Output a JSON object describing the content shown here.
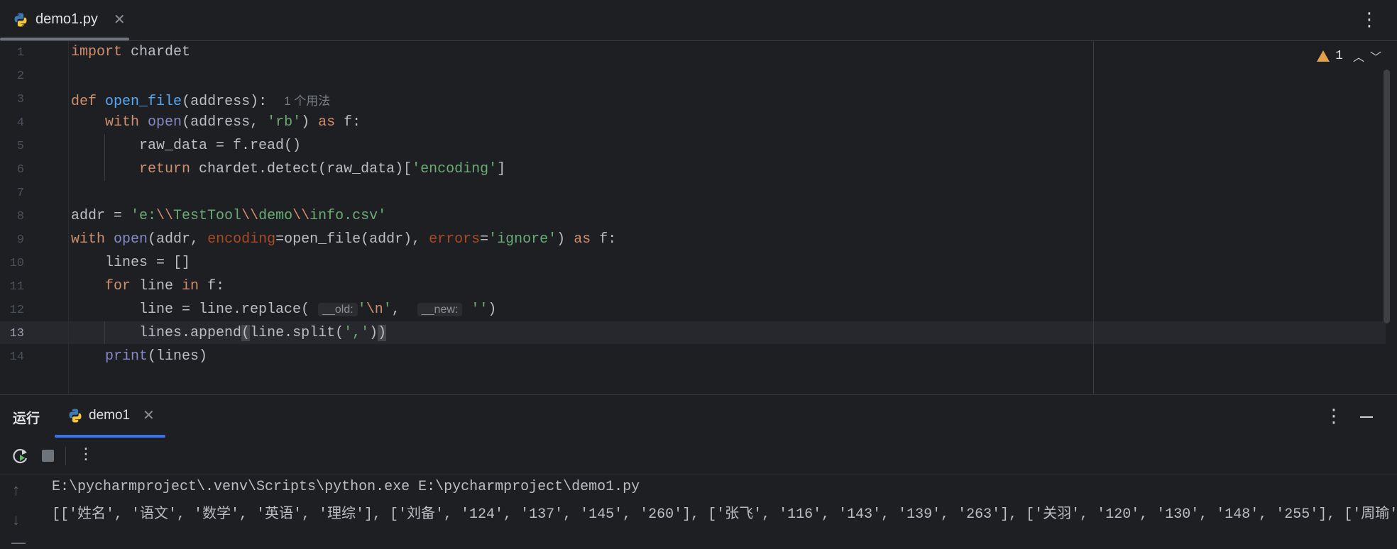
{
  "tab": {
    "title": "demo1.py",
    "close": "✕"
  },
  "warnings": {
    "count": "1"
  },
  "editor": {
    "lines": [
      {
        "n": "1"
      },
      {
        "n": "2"
      },
      {
        "n": "3"
      },
      {
        "n": "4"
      },
      {
        "n": "5"
      },
      {
        "n": "6"
      },
      {
        "n": "7"
      },
      {
        "n": "8"
      },
      {
        "n": "9"
      },
      {
        "n": "10"
      },
      {
        "n": "11"
      },
      {
        "n": "12"
      },
      {
        "n": "13"
      },
      {
        "n": "14"
      }
    ],
    "code": {
      "l1_kw": "import",
      "l1_rest": " chardet",
      "l3_kw": "def",
      "l3_fn": "open_file",
      "l3_rest": "(address):",
      "l3_hint": "1 个用法",
      "l4_kw1": "with",
      "l4_bi": "open",
      "l4_a": "(address, ",
      "l4_str": "'rb'",
      "l4_b": ") ",
      "l4_kw2": "as",
      "l4_c": " f:",
      "l5": "raw_data = f.read()",
      "l6_kw": "return",
      "l6_a": " chardet.detect(raw_data)[",
      "l6_str": "'encoding'",
      "l6_b": "]",
      "l8_a": "addr = ",
      "l8_s1": "'e:",
      "l8_e1": "\\\\",
      "l8_s2": "TestTool",
      "l8_e2": "\\\\",
      "l8_s3": "demo",
      "l8_e3": "\\\\",
      "l8_s4": "info.csv'",
      "l9_kw1": "with",
      "l9_bi": "open",
      "l9_a": "(addr, ",
      "l9_p1": "encoding",
      "l9_b": "=open_file(addr), ",
      "l9_p2": "errors",
      "l9_c": "=",
      "l9_str": "'ignore'",
      "l9_d": ") ",
      "l9_kw2": "as",
      "l9_e": " f:",
      "l10": "lines = []",
      "l11_kw1": "for",
      "l11_a": " line ",
      "l11_kw2": "in",
      "l11_b": " f:",
      "l12_a": "line = line.replace(",
      "l12_h1": "__old:",
      "l12_s1": "'",
      "l12_e": "\\n",
      "l12_s1b": "'",
      "l12_b": ", ",
      "l12_h2": "__new:",
      "l12_s2": "''",
      "l12_c": ")",
      "l13_a": "lines.append",
      "l13_p1": "(",
      "l13_b": "line.split(",
      "l13_str": "','",
      "l13_c": ")",
      "l13_p2": ")",
      "l14_bi": "print",
      "l14_a": "(lines)"
    }
  },
  "run": {
    "title": "运行",
    "tab_label": "demo1",
    "tab_close": "✕",
    "console": [
      "E:\\pycharmproject\\.venv\\Scripts\\python.exe E:\\pycharmproject\\demo1.py",
      "[['姓名', '语文', '数学', '英语', '理综'], ['刘备', '124', '137', '145', '260'], ['张飞', '116', '143', '139', '263'], ['关羽', '120', '130', '148', '255'], ['周瑜'"
    ]
  },
  "colors": {
    "background": "#1e1f22",
    "keyword": "#cf8e6d",
    "function": "#56a8f5",
    "string": "#6aab73",
    "builtin": "#8888c6",
    "accent": "#3574f0",
    "warning": "#e0a04b"
  }
}
